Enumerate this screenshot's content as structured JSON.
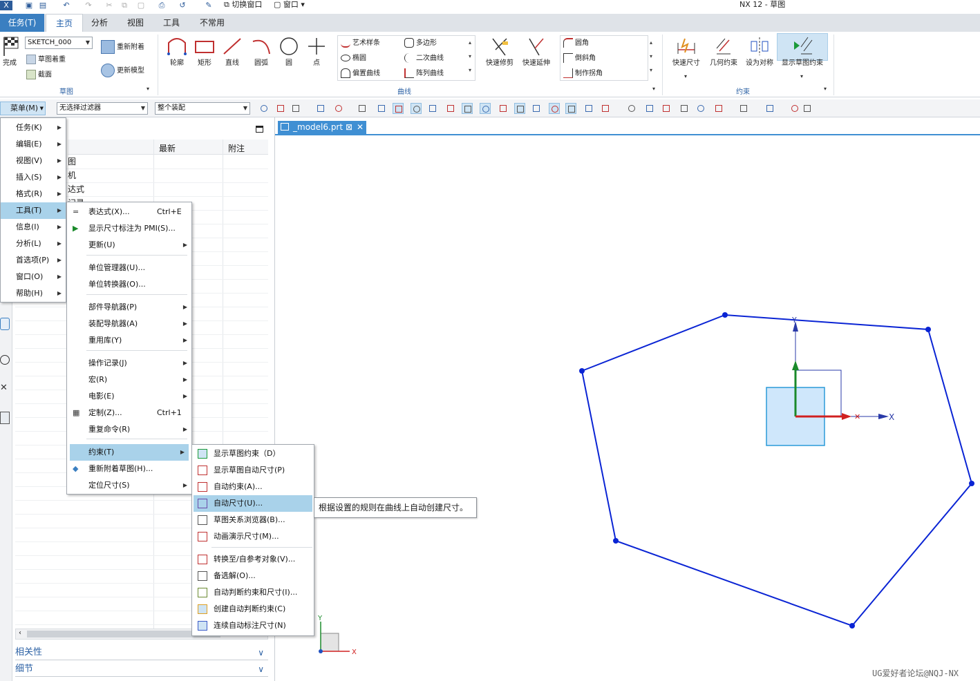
{
  "window": {
    "title": "NX 12 - 草图"
  },
  "quick_access": {
    "switch_window": "切换窗口",
    "window": "窗口"
  },
  "tabs": [
    {
      "label": "任务(T)"
    },
    {
      "label": "主页"
    },
    {
      "label": "分析"
    },
    {
      "label": "视图"
    },
    {
      "label": "工具"
    },
    {
      "label": "不常用"
    }
  ],
  "ribbon": {
    "sketch_group": {
      "finish": "完成",
      "sketch_name": "SKETCH_000",
      "reattach": "重新附着",
      "sketch_orient": "草图着重",
      "section": "截面",
      "update_model": "更新模型",
      "label": "草图"
    },
    "curve_group": {
      "profile": "轮廓",
      "rectangle": "矩形",
      "line": "直线",
      "arc": "圆弧",
      "circle": "圆",
      "point": "点",
      "studio_spline": "艺术样条",
      "ellipse": "椭圆",
      "offset_curve": "偏置曲线",
      "polygon": "多边形",
      "conic": "二次曲线",
      "pattern_curve": "阵列曲线",
      "quick_trim": "快速修剪",
      "quick_extend": "快速延伸",
      "fillet": "圆角",
      "chamfer": "倒斜角",
      "make_corner": "制作拐角",
      "label": "曲线"
    },
    "constraint_group": {
      "rapid_dimension": "快速尺寸",
      "geometric_constraints": "几何约束",
      "make_symmetric": "设为对称",
      "show_constraints": "显示草图约束",
      "label": "约束"
    }
  },
  "toolbar2": {
    "menu_button": "菜单(M)",
    "filter": "无选择过滤器",
    "scope": "整个装配"
  },
  "nav_panel": {
    "columns": [
      "最新",
      "附注"
    ],
    "rows": [
      "图",
      "机",
      "达式",
      "记录"
    ],
    "footers": [
      "相关性",
      "细节"
    ]
  },
  "document_tab": {
    "label": "_model6.prt"
  },
  "main_menu": [
    {
      "label": "任务(K)"
    },
    {
      "label": "编辑(E)"
    },
    {
      "label": "视图(V)"
    },
    {
      "label": "插入(S)"
    },
    {
      "label": "格式(R)"
    },
    {
      "label": "工具(T)"
    },
    {
      "label": "信息(I)"
    },
    {
      "label": "分析(L)"
    },
    {
      "label": "首选项(P)"
    },
    {
      "label": "窗口(O)"
    },
    {
      "label": "帮助(H)"
    }
  ],
  "tools_menu": [
    {
      "label": "表达式(X)...",
      "accel": "Ctrl+E"
    },
    {
      "label": "显示尺寸标注为 PMI(S)..."
    },
    {
      "label": "更新(U)"
    },
    {
      "label": "单位管理器(U)..."
    },
    {
      "label": "单位转换器(O)..."
    },
    {
      "label": "部件导航器(P)"
    },
    {
      "label": "装配导航器(A)"
    },
    {
      "label": "重用库(Y)"
    },
    {
      "label": "操作记录(J)"
    },
    {
      "label": "宏(R)"
    },
    {
      "label": "电影(E)"
    },
    {
      "label": "定制(Z)...",
      "accel": "Ctrl+1"
    },
    {
      "label": "重复命令(R)"
    },
    {
      "label": "约束(T)"
    },
    {
      "label": "重新附着草图(H)..."
    },
    {
      "label": "定位尺寸(S)"
    }
  ],
  "constraints_menu": [
    {
      "label": "显示草图约束（D）"
    },
    {
      "label": "显示草图自动尺寸(P)"
    },
    {
      "label": "自动约束(A)..."
    },
    {
      "label": "自动尺寸(U)..."
    },
    {
      "label": "草图关系浏览器(B)..."
    },
    {
      "label": "动画演示尺寸(M)..."
    },
    {
      "label": "转换至/自参考对象(V)..."
    },
    {
      "label": "备选解(O)..."
    },
    {
      "label": "自动判断约束和尺寸(I)..."
    },
    {
      "label": "创建自动判断约束(C)"
    },
    {
      "label": "连续自动标注尺寸(N)"
    }
  ],
  "tooltip": {
    "text": "根据设置的规则在曲线上自动创建尺寸。"
  },
  "axes": {
    "x": "X",
    "y": "Y"
  },
  "watermark": "UG爱好者论坛@NQJ-NX",
  "colors": {
    "accent": "#3a7fc1",
    "highlight": "#a9d2ea",
    "sketch": "#0a24d4",
    "x_axis": "#d02020",
    "y_axis": "#1a8a2a"
  }
}
